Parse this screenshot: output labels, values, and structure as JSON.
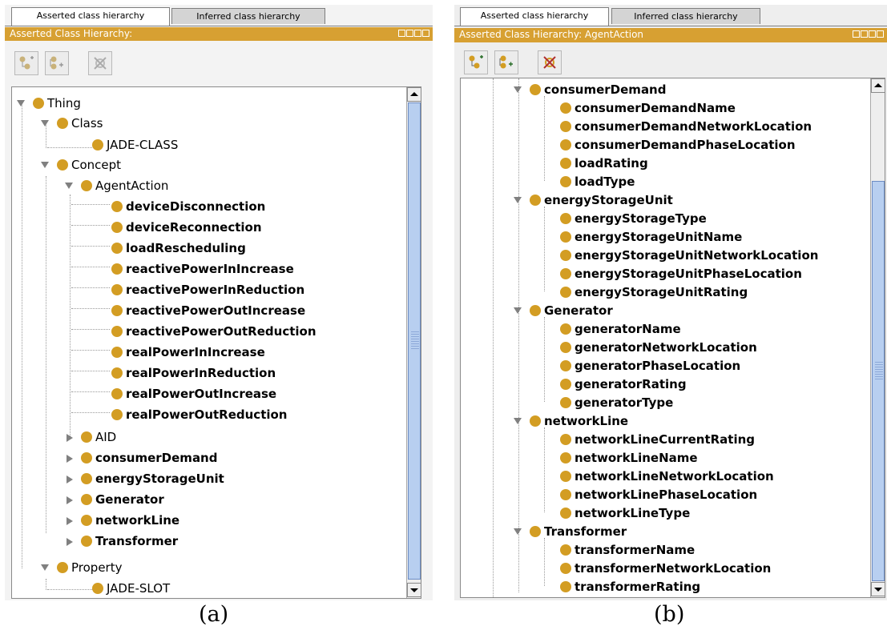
{
  "panel_a": {
    "tabs": [
      "Asserted class hierarchy",
      "Inferred class hierarchy"
    ],
    "title": "Asserted Class Hierarchy:",
    "tree": {
      "thing": "Thing",
      "class": "Class",
      "jade_class": "JADE-CLASS",
      "concept": "Concept",
      "agent_action": "AgentAction",
      "actions": [
        "deviceDisconnection",
        "deviceReconnection",
        "loadRescheduling",
        "reactivePowerInIncrease",
        "reactivePowerInReduction",
        "reactivePowerOutIncrease",
        "reactivePowerOutReduction",
        "realPowerInIncrease",
        "realPowerInReduction",
        "realPowerOutIncrease",
        "realPowerOutReduction"
      ],
      "aid": "AID",
      "collapsed": [
        "consumerDemand",
        "energyStorageUnit",
        "Generator",
        "networkLine",
        "Transformer"
      ],
      "property": "Property",
      "jade_slot": "JADE-SLOT"
    }
  },
  "panel_b": {
    "tabs": [
      "Asserted class hierarchy",
      "Inferred class hierarchy"
    ],
    "title": "Asserted Class Hierarchy: AgentAction",
    "groups": [
      {
        "name": "consumerDemand",
        "children": [
          "consumerDemandName",
          "consumerDemandNetworkLocation",
          "consumerDemandPhaseLocation",
          "loadRating",
          "loadType"
        ]
      },
      {
        "name": "energyStorageUnit",
        "children": [
          "energyStorageType",
          "energyStorageUnitName",
          "energyStorageUnitNetworkLocation",
          "energyStorageUnitPhaseLocation",
          "energyStorageUnitRating"
        ]
      },
      {
        "name": "Generator",
        "children": [
          "generatorName",
          "generatorNetworkLocation",
          "generatorPhaseLocation",
          "generatorRating",
          "generatorType"
        ]
      },
      {
        "name": "networkLine",
        "children": [
          "networkLineCurrentRating",
          "networkLineName",
          "networkLineNetworkLocation",
          "networkLinePhaseLocation",
          "networkLineType"
        ]
      },
      {
        "name": "Transformer",
        "children": [
          "transformerName",
          "transformerNetworkLocation",
          "transformerRating"
        ]
      }
    ]
  },
  "captions": {
    "a": "(a)",
    "b": "(b)"
  },
  "colors": {
    "titlebar": "#d7a032",
    "bullet": "#d39d23",
    "scroll_thumb": "#b8cff0"
  },
  "icons": [
    "add-subclass-icon",
    "add-sibling-icon",
    "delete-class-icon",
    "window-controls-icon",
    "scroll-up-icon",
    "scroll-down-icon"
  ]
}
